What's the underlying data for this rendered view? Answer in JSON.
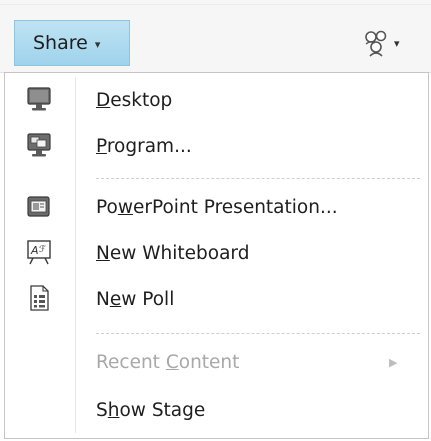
{
  "toolbar": {
    "share_label": "Share",
    "share_caret": "▾",
    "people_caret": "▾"
  },
  "menu": {
    "items": [
      {
        "id": "desktop",
        "pre": "",
        "accel": "D",
        "post": "esktop",
        "icon": "monitor-icon",
        "enabled": true
      },
      {
        "id": "program",
        "pre": "",
        "accel": "P",
        "post": "rogram...",
        "icon": "program-windows-icon",
        "enabled": true
      },
      {
        "id": "powerpoint",
        "pre": "Po",
        "accel": "w",
        "post": "erPoint Presentation...",
        "icon": "presentation-icon",
        "enabled": true
      },
      {
        "id": "whiteboard",
        "pre": "",
        "accel": "N",
        "post": "ew Whiteboard",
        "icon": "whiteboard-icon",
        "enabled": true
      },
      {
        "id": "poll",
        "pre": "N",
        "accel": "e",
        "post": "w Poll",
        "icon": "poll-icon",
        "enabled": true
      },
      {
        "id": "recent",
        "pre": "Recent ",
        "accel": "C",
        "post": "ontent",
        "icon": "",
        "enabled": false,
        "submenu_arrow": "▶"
      },
      {
        "id": "stage",
        "pre": "S",
        "accel": "h",
        "post": "ow Stage",
        "icon": "",
        "enabled": true
      }
    ]
  }
}
